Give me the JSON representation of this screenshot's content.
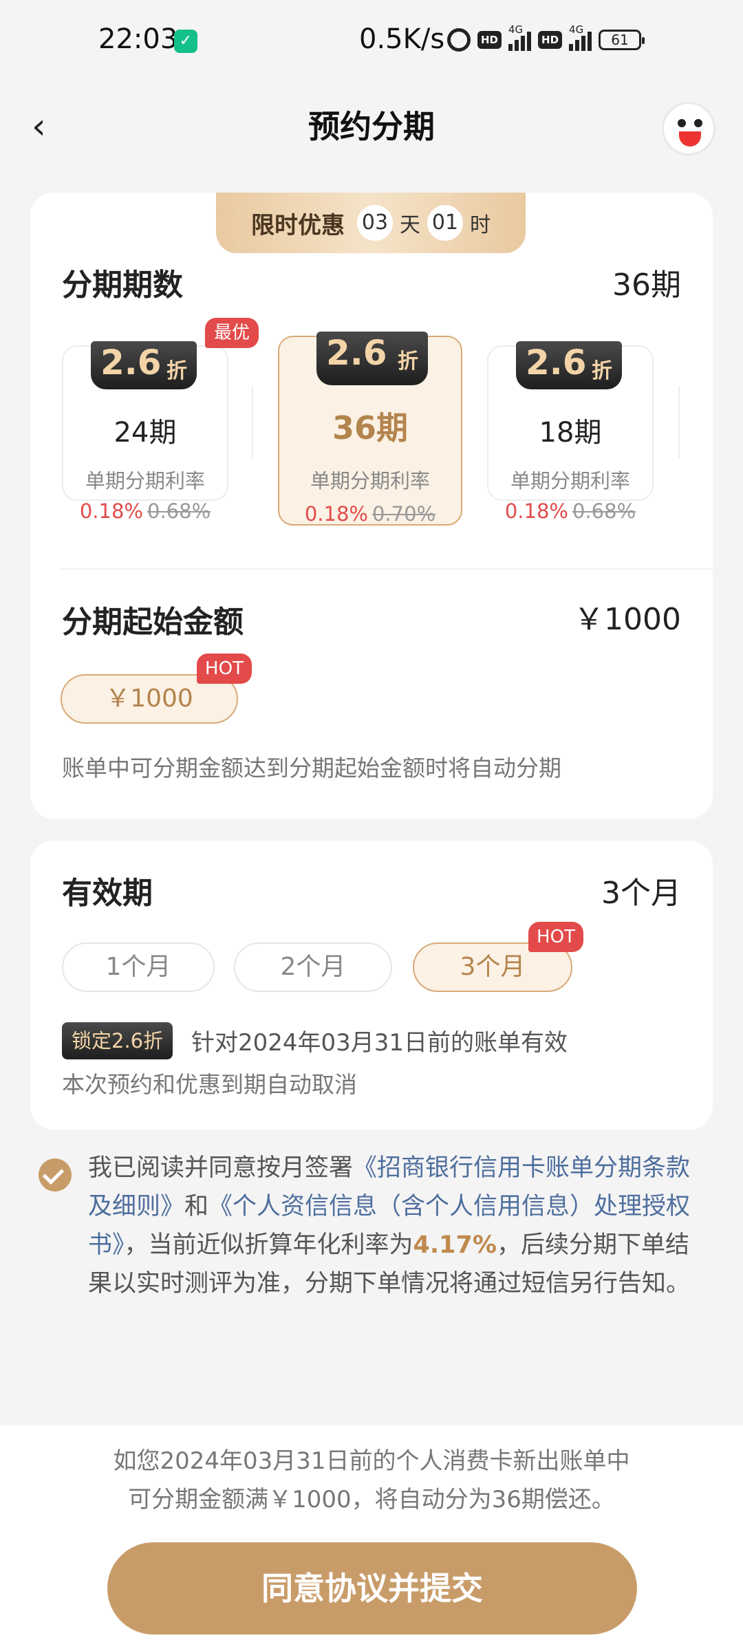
{
  "status_bar": {
    "time": "22:03",
    "network_speed": "0.5K/s",
    "hd": "HD",
    "signal_type": "4G",
    "battery": "61"
  },
  "nav": {
    "title": "预约分期"
  },
  "promo": {
    "label": "限时优惠",
    "days": "03",
    "days_unit": "天",
    "hours": "01",
    "hours_unit": "时"
  },
  "installments": {
    "title": "分期期数",
    "selected": "36期",
    "best_badge": "最优",
    "options": [
      {
        "discount": "2.6",
        "discount_unit": "折",
        "period": "24期",
        "rate_label": "单期分期利率",
        "rate": "0.18%",
        "old_rate": "0.68%"
      },
      {
        "discount": "2.6",
        "discount_unit": "折",
        "period": "36期",
        "rate_label": "单期分期利率",
        "rate": "0.18%",
        "old_rate": "0.70%"
      },
      {
        "discount": "2.6",
        "discount_unit": "折",
        "period": "18期",
        "rate_label": "单期分期利率",
        "rate": "0.18%",
        "old_rate": "0.68%"
      }
    ]
  },
  "amount": {
    "title": "分期起始金额",
    "value": "￥1000",
    "chip": "￥1000",
    "hot": "HOT",
    "hint": "账单中可分期金额达到分期起始金额时将自动分期"
  },
  "validity": {
    "title": "有效期",
    "value": "3个月",
    "hot": "HOT",
    "options": [
      "1个月",
      "2个月",
      "3个月"
    ],
    "lock_badge": "锁定2.6折",
    "lock_desc": "针对2024年03月31日前的账单有效",
    "auto_cancel": "本次预约和优惠到期自动取消"
  },
  "agreement": {
    "p1": "我已阅读并同意按月签署",
    "link1": "《招商银行信用卡账单分期条款及细则》",
    "p2": "和",
    "link2": "《个人资信信息（含个人信用信息）处理授权书》",
    "p3": "，当前近似折算年化利率为",
    "rate": "4.17%",
    "p4": "，后续分期下单结果以实时测评为准，分期下单情况将通过短信另行告知。"
  },
  "bottom": {
    "note_line1": "如您2024年03月31日前的个人消费卡新出账单中",
    "note_line2": "可分期金额满￥1000，将自动分为36期偿还。",
    "submit": "同意协议并提交"
  },
  "colors": {
    "accent": "#c89c69",
    "accent_text": "#b3844d",
    "red": "#e34a4a",
    "link": "#4e6e9e",
    "background": "#f4f4f4"
  }
}
